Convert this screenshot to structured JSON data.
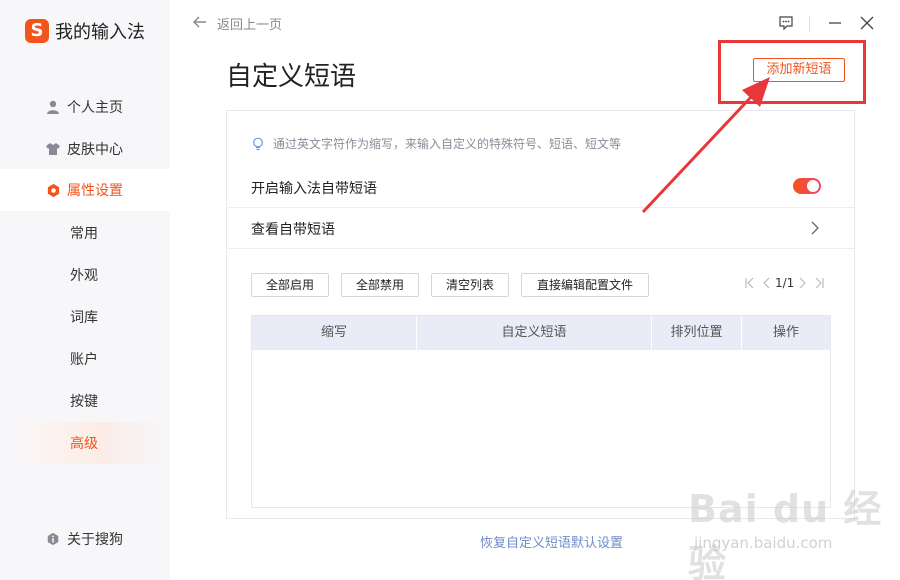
{
  "app": {
    "logo_letter": "S",
    "title": "我的输入法",
    "brand_color": "#f2541b"
  },
  "sidebar": {
    "items": [
      {
        "label": "个人主页",
        "icon": "user-icon"
      },
      {
        "label": "皮肤中心",
        "icon": "shirt-icon"
      },
      {
        "label": "属性设置",
        "icon": "settings-hex-icon",
        "active": true
      }
    ],
    "sub_items": [
      {
        "label": "常用"
      },
      {
        "label": "外观"
      },
      {
        "label": "词库"
      },
      {
        "label": "账户"
      },
      {
        "label": "按键"
      },
      {
        "label": "高级",
        "active": true
      }
    ],
    "footer": {
      "label": "关于搜狗",
      "icon": "info-icon"
    }
  },
  "header": {
    "back_label": "返回上一页"
  },
  "main": {
    "title": "自定义短语",
    "add_button": "添加新短语",
    "hint": "通过英文字符作为缩写，来输入自定义的特殊符号、短语、短文等",
    "toggle_label": "开启输入法自带短语",
    "toggle_on": true,
    "view_label": "查看自带短语",
    "buttons": [
      "全部启用",
      "全部禁用",
      "清空列表",
      "直接编辑配置文件"
    ],
    "pager": {
      "text": "1/1"
    },
    "table": {
      "columns": [
        "缩写",
        "自定义短语",
        "排列位置",
        "操作"
      ],
      "rows": []
    },
    "restore_link": "恢复自定义短语默认设置"
  },
  "annotation": {
    "color": "#e8373b"
  },
  "watermark": {
    "main": "Bai du 经验",
    "sub": "jingyan.baidu.com"
  }
}
